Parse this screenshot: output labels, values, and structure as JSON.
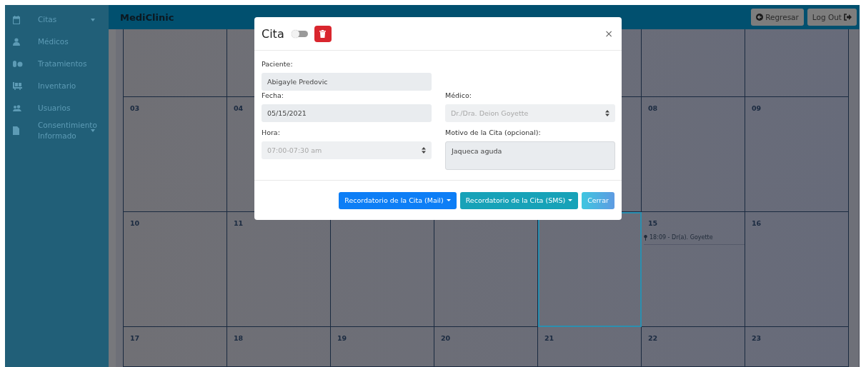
{
  "sidebar": {
    "items": [
      {
        "label": "Citas",
        "has_submenu": true
      },
      {
        "label": "Médicos",
        "has_submenu": false
      },
      {
        "label": "Tratamientos",
        "has_submenu": false
      },
      {
        "label": "Inventario",
        "has_submenu": false
      },
      {
        "label": "Usuarios",
        "has_submenu": false
      },
      {
        "label": "Consentimiento Informado",
        "has_submenu": true
      }
    ]
  },
  "topbar": {
    "brand": "MediClinic",
    "buttons": [
      {
        "label": "Regresar"
      },
      {
        "label": "Log Out"
      }
    ]
  },
  "calendar": {
    "weeks": [
      [
        {
          "today": false
        },
        {
          "today": false
        },
        {
          "today": false
        },
        {
          "today": false
        }
      ],
      [
        {
          "day": "03",
          "today": false
        },
        {
          "day": "04",
          "today": false
        },
        {
          "day": "08",
          "today": false
        },
        {
          "day": "09",
          "today": false
        }
      ],
      [
        {
          "day": "10",
          "today": false
        },
        {
          "day": "11",
          "today": false
        },
        {
          "today": false
        },
        {
          "today": false
        },
        {
          "today": true
        },
        {
          "day": "15",
          "today": false,
          "events": [
            "18:09 - Dr(a). Goyette"
          ]
        },
        {
          "day": "16",
          "today": false
        }
      ],
      [
        {
          "day": "17",
          "today": false
        },
        {
          "day": "18",
          "today": false
        },
        {
          "day": "19",
          "today": false
        },
        {
          "day": "20",
          "today": false
        },
        {
          "day": "21",
          "today": false
        },
        {
          "day": "22",
          "today": false
        },
        {
          "day": "23",
          "today": false
        }
      ]
    ]
  },
  "modal": {
    "title": "Cita",
    "toggle_on": false,
    "close": "×",
    "fields": [
      {
        "kind": "input",
        "label": "Paciente:",
        "value": "Abigayle Predovic",
        "disabled": false
      },
      {
        "kind": "spacer"
      },
      {
        "kind": "input",
        "label": "Fecha:",
        "value": "05/15/2021",
        "disabled": false
      },
      {
        "kind": "select",
        "label": "Médico:",
        "value": "Dr./Dra. Deion Goyette",
        "disabled": true
      },
      {
        "kind": "select",
        "label": "Hora:",
        "value": "07:00-07:30 am",
        "disabled": true
      },
      {
        "kind": "textarea",
        "label": "Motivo de la Cita (opcional):",
        "value": "Jaqueca aguda",
        "disabled": false
      }
    ],
    "buttons": [
      {
        "label": "Recordatorio de la Cita (Mail)",
        "kind": "primary",
        "dropdown": true
      },
      {
        "label": "Recordatorio de la Cita (SMS)",
        "kind": "teal",
        "dropdown": true
      },
      {
        "label": "Cerrar",
        "kind": "info",
        "dropdown": false
      }
    ]
  }
}
